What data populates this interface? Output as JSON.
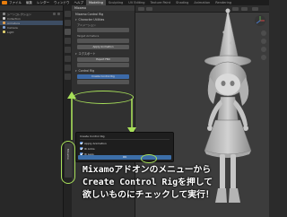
{
  "menubar": {
    "items": [
      "ファイル",
      "編集",
      "レンダー",
      "ウィンドウ",
      "ヘルプ"
    ]
  },
  "workspace_tabs": {
    "items": [
      "Modeling",
      "Sculpting",
      "UV Editing",
      "Texture Paint",
      "Shading",
      "Animation",
      "Rendering"
    ]
  },
  "outliner": {
    "rows": [
      "シーンコレクション",
      "Collection",
      "Armature",
      "Camera",
      "Light"
    ]
  },
  "panel": {
    "header": "Mixamo",
    "title": "Mixamo Control Rig",
    "section_rig": "Character Utilities",
    "label_anim": "アニメーション",
    "label_target": "Target Armature",
    "section_export": "エクスポート",
    "section_controlrig": "Control Rig",
    "btn_create": "Create Control Rig",
    "btn_apply": "Apply Animation",
    "btn_export": "Export FBX"
  },
  "vertical_tab": {
    "label": "Mixamo"
  },
  "dialog": {
    "title": "Create Control Rig",
    "options": [
      "Apply Animation",
      "IK Arms",
      "IK Legs"
    ],
    "ok_label": "OK"
  },
  "caption": {
    "line1": "Mixamoアドオンのメニューから",
    "line2": "Create Control Rigを押して",
    "line3": "欲しいものにチェックして実行！"
  },
  "colors": {
    "highlight": "#a8e05a",
    "accent": "#3c6ea8"
  }
}
